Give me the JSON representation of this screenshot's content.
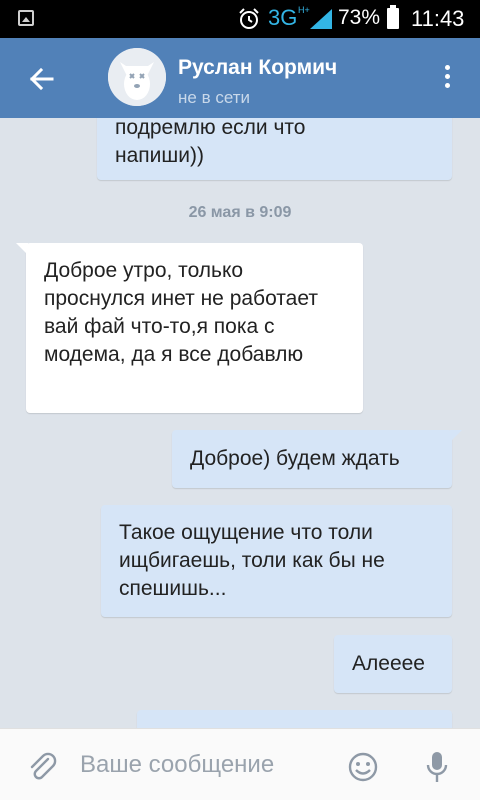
{
  "status_bar": {
    "network": "3G",
    "network_sup": "H+",
    "battery_percent": "73%",
    "time": "11:43"
  },
  "header": {
    "contact_name": "Руслан Кормич",
    "contact_status": "не в сети"
  },
  "messages": [
    {
      "direction": "out",
      "text_line1": "подремлю если что",
      "text_line2": "напиши))"
    },
    {
      "date_separator": "26 мая в 9:09"
    },
    {
      "direction": "in",
      "text": "Доброе утро, только проснулся инет не работает вай фай что-то,я пока с модема, да я все добавлю"
    },
    {
      "direction": "out",
      "text": "Доброе) будем ждать"
    },
    {
      "direction": "out",
      "text": "Такое ощущение что толи ищбигаешь, толи как бы не спешишь..."
    },
    {
      "direction": "out",
      "text": "Алееее"
    }
  ],
  "input": {
    "placeholder": "Ваше сообщение"
  },
  "colors": {
    "header": "#5181b8",
    "outgoing_bubble": "#d6e5f7",
    "incoming_bubble": "#ffffff",
    "chat_background": "#dde3ea",
    "network_accent": "#33b5e5"
  },
  "icons": [
    "image-icon",
    "alarm-icon",
    "signal-icon",
    "battery-icon",
    "back-arrow-icon",
    "more-vertical-icon",
    "paperclip-icon",
    "emoji-icon",
    "microphone-icon"
  ]
}
